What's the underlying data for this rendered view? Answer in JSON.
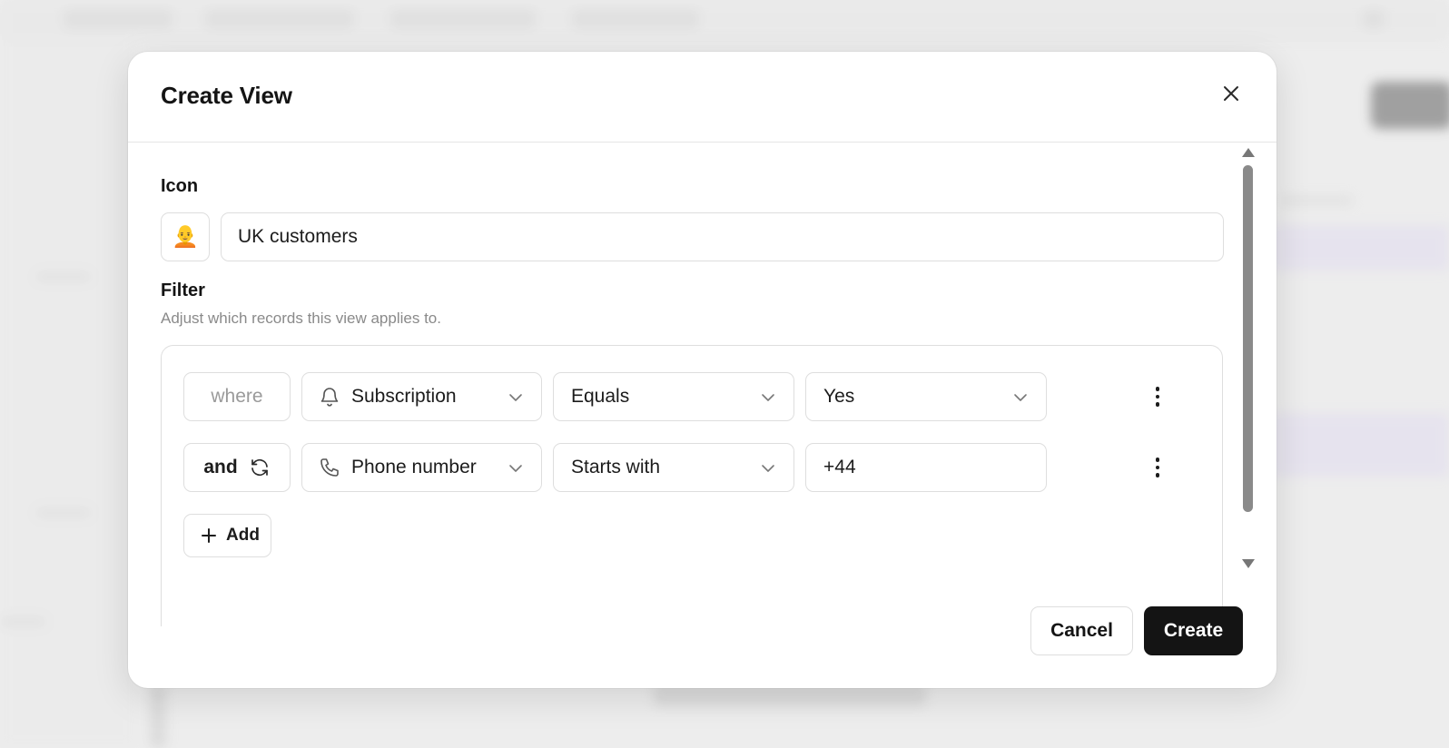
{
  "modal": {
    "title": "Create View",
    "icon_label": "Icon",
    "icon_emoji": "🧑‍🦲",
    "name_value": "UK customers",
    "filter_label": "Filter",
    "filter_description": "Adjust which records this view applies to."
  },
  "filters": {
    "rows": [
      {
        "conjunction": "where",
        "field": "Subscription",
        "field_icon": "bell-icon",
        "operator": "Equals",
        "value": "Yes",
        "value_type": "select"
      },
      {
        "conjunction": "and",
        "field": "Phone number",
        "field_icon": "phone-icon",
        "operator": "Starts with",
        "value": "+44",
        "value_type": "text"
      }
    ],
    "add_label": "Add"
  },
  "footer": {
    "cancel_label": "Cancel",
    "create_label": "Create"
  },
  "colors": {
    "primary_button": "#141414",
    "border": "#dedede",
    "muted_text": "#8a8a8a"
  }
}
